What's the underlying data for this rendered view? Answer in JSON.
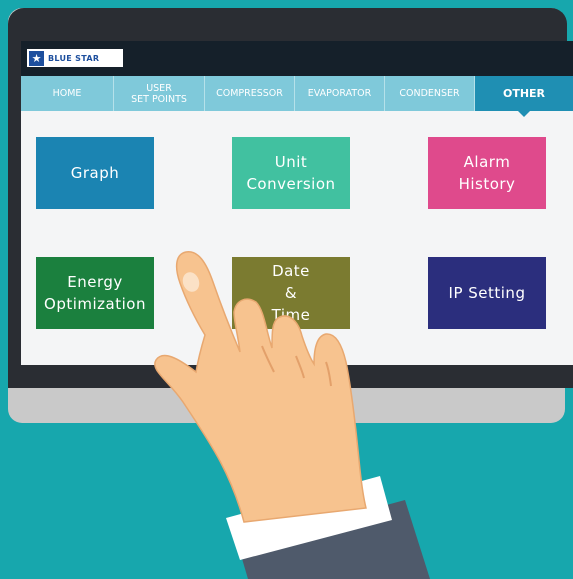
{
  "brand": {
    "name": "BLUE STAR"
  },
  "tabs": [
    {
      "label": "HOME",
      "active": false
    },
    {
      "label": "USER\nSET POINTS",
      "active": false
    },
    {
      "label": "COMPRESSOR",
      "active": false
    },
    {
      "label": "EVAPORATOR",
      "active": false
    },
    {
      "label": "CONDENSER",
      "active": false
    },
    {
      "label": "OTHER",
      "active": true
    }
  ],
  "tiles": [
    {
      "label": "Graph",
      "color": "#1b84b2"
    },
    {
      "label": "Unit\nConversion",
      "color": "#41c1a0"
    },
    {
      "label": "Alarm\nHistory",
      "color": "#df4a8c"
    },
    {
      "label": "Energy\nOptimization",
      "color": "#1b803e"
    },
    {
      "label": "Date\n&\nTime",
      "color": "#7b7b30"
    },
    {
      "label": "IP Setting",
      "color": "#2b2e7d"
    }
  ],
  "colors": {
    "background": "#17a7ad",
    "bezel": "#2a2d33",
    "nav": "#7fc9da",
    "nav_active": "#1f8fb3"
  }
}
